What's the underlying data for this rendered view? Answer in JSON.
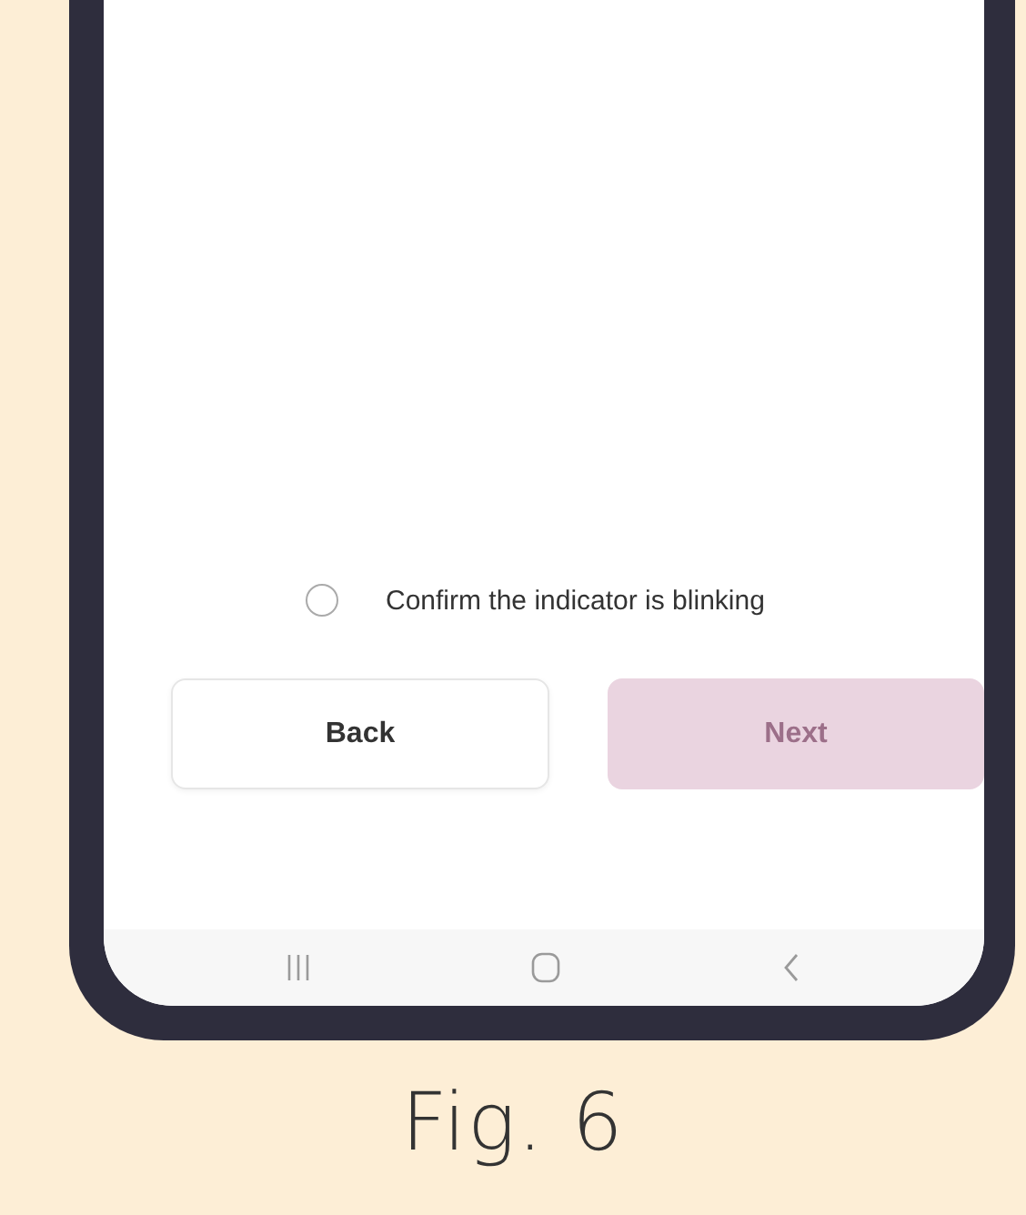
{
  "confirm": {
    "label": "Confirm the indicator is blinking",
    "checked": false
  },
  "buttons": [
    {
      "label": "Back",
      "disabled": false
    },
    {
      "label": "Next",
      "disabled": true
    }
  ],
  "caption": "Fig. 6"
}
